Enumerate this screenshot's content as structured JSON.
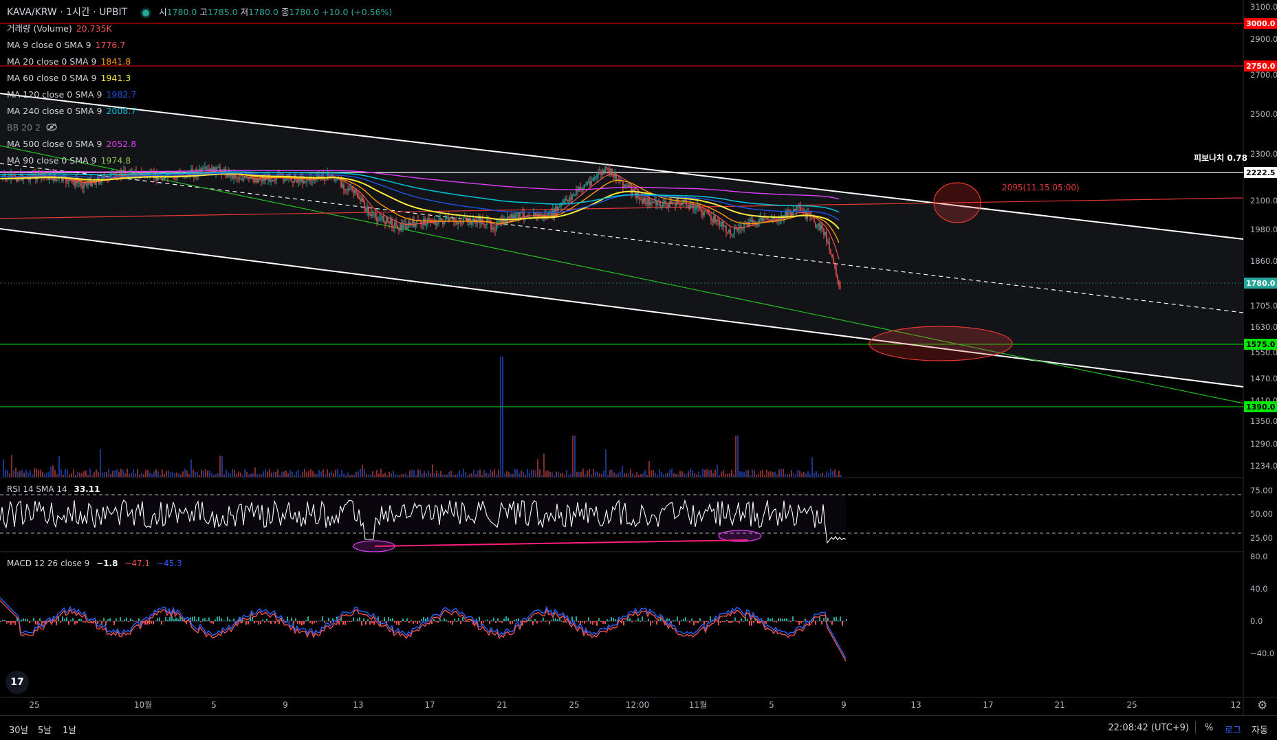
{
  "header": {
    "symbol_title": "KAVA/KRW · 1시간 · UPBIT",
    "open_label": "시",
    "open": "1780.0",
    "high_label": "고",
    "high": "1785.0",
    "low_label": "저",
    "low": "1780.0",
    "close_label": "종",
    "close": "1780.0",
    "change": "+10.0 (+0.56%)"
  },
  "indicators": [
    {
      "label": "거래량 (Volume)",
      "value": "20.735K",
      "color": "#ef5350"
    },
    {
      "label": "MA 9 close 0 SMA 9",
      "value": "1776.7",
      "color": "#ef5350"
    },
    {
      "label": "MA 20 close 0 SMA 9",
      "value": "1841.8",
      "color": "#ff9800"
    },
    {
      "label": "MA 60 close 0 SMA 9",
      "value": "1941.3",
      "color": "#ffeb3b"
    },
    {
      "label": "MA 120 close 0 SMA 9",
      "value": "1982.7",
      "color": "#1e53e5"
    },
    {
      "label": "MA 240 close 0 SMA 9",
      "value": "2008.7",
      "color": "#00bcd4"
    },
    {
      "label": "BB 20 2",
      "value": "",
      "color": "#787b86"
    },
    {
      "label": "MA 500 close 0 SMA 9",
      "value": "2052.8",
      "color": "#e040fb"
    },
    {
      "label": "MA 90 close 0 SMA 9",
      "value": "1974.8",
      "color": "#8bc34a"
    }
  ],
  "rsi": {
    "label": "RSI 14 SMA 14",
    "value": "33.11"
  },
  "macd": {
    "label": "MACD 12 26 close 9",
    "v1": "−1.8",
    "v2": "−47.1",
    "v3": "−45.3"
  },
  "annotations": {
    "fib_label": "피보나치 0.78",
    "target_label": "2095(11.15 05:00)"
  },
  "price_axis": {
    "ticks": [
      "3100.0",
      "2900.0",
      "2700.0",
      "2500.0",
      "2300.0",
      "2100.0",
      "1980.0",
      "1860.0",
      "1705.0",
      "1630.0",
      "1550.0",
      "1470.0",
      "1410.0",
      "1350.0",
      "1290.0",
      "1234.0"
    ],
    "badges": [
      {
        "text": "3000.0",
        "color": "#ff0000",
        "fg": "#ffffff"
      },
      {
        "text": "2750.0",
        "color": "#ff0000",
        "fg": "#ffffff"
      },
      {
        "text": "2222.5",
        "color": "#ffffff",
        "fg": "#000000"
      },
      {
        "text": "1780.0",
        "color": "#26a69a",
        "fg": "#ffffff"
      },
      {
        "text": "1575.0",
        "color": "#00e600",
        "fg": "#000000"
      },
      {
        "text": "1390.0",
        "color": "#00e600",
        "fg": "#000000"
      }
    ]
  },
  "rsi_axis": {
    "ticks": [
      "75.00",
      "50.00",
      "25.00"
    ]
  },
  "macd_axis": {
    "ticks": [
      "80.0",
      "40.0",
      "0.0",
      "−40.0"
    ]
  },
  "time_axis": {
    "labels": [
      "25",
      "10월",
      "5",
      "9",
      "13",
      "17",
      "21",
      "25",
      "12:00",
      "11월",
      "5",
      "9",
      "13",
      "17",
      "21",
      "25",
      "12"
    ]
  },
  "bottom": {
    "ranges": [
      "30날",
      "5날",
      "1날"
    ],
    "clock": "22:08:42 (UTC+9)",
    "percent": "%",
    "log": "로그",
    "auto": "자동"
  },
  "logo_text": "17"
}
